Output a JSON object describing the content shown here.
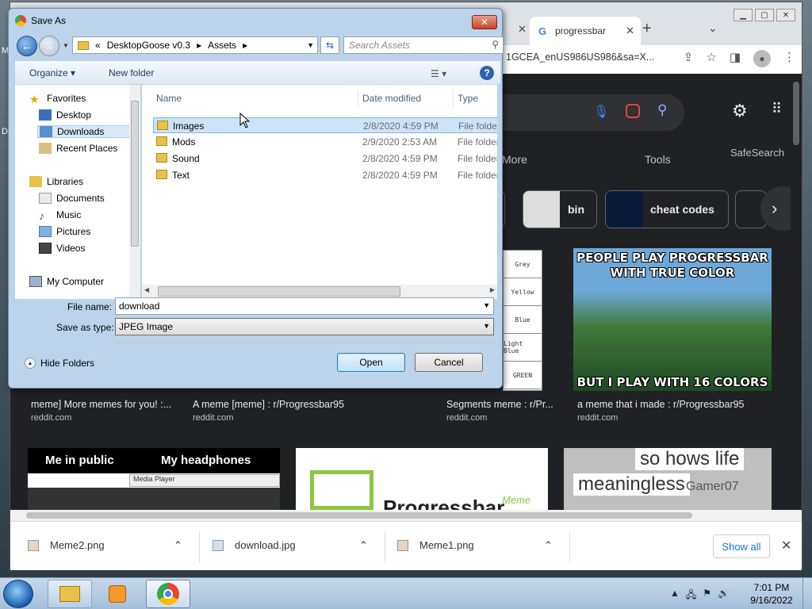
{
  "desktop": {
    "letters": [
      "M",
      "D"
    ]
  },
  "browser": {
    "tab_title": "progressbar",
    "url_fragment": "1GCEA_enUS986US986&sa=X...",
    "nav_more": "More",
    "nav_tools": "Tools",
    "nav_safesearch": "SafeSearch",
    "chips": [
      {
        "label": "bin"
      },
      {
        "label": "cheat codes"
      }
    ],
    "color_strip": [
      "Grey",
      "Yellow",
      "Blue",
      "Light Blue",
      "GREEN"
    ],
    "meme_top_text": "PEOPLE PLAY PROGRESSBAR WITH TRUE COLOR",
    "meme_bottom_text": "BUT I PLAY WITH 16 COLORS",
    "results": [
      {
        "title": "meme] More memes for you! :...",
        "source": "reddit.com"
      },
      {
        "title": "A meme [meme] : r/Progressbar95",
        "source": "reddit.com"
      },
      {
        "title": "Segments meme : r/Pr...",
        "source": "reddit.com"
      },
      {
        "title": "a meme that i made : r/Progressbar95",
        "source": "reddit.com"
      }
    ],
    "row2": {
      "public_text": "Me in public",
      "headphones_text": "My headphones",
      "media_player": "Media Player",
      "progressbar_text": "Progressbar",
      "meme_text": "Meme",
      "hows_life": "so hows life",
      "meaningless": "meaningless",
      "gamer": "Gamer07"
    },
    "downloads": [
      {
        "name": "Meme2.png"
      },
      {
        "name": "download.jpg"
      },
      {
        "name": "Meme1.png"
      }
    ],
    "show_all": "Show all"
  },
  "dialog": {
    "title": "Save As",
    "breadcrumb": [
      "«",
      "DesktopGoose v0.3",
      "▸",
      "Assets",
      "▸"
    ],
    "search_placeholder": "Search Assets",
    "organize": "Organize ▾",
    "new_folder": "New folder",
    "nav": [
      {
        "label": "Favorites",
        "icon": "star-icon"
      },
      {
        "label": "Desktop",
        "icon": "desktop-icon"
      },
      {
        "label": "Downloads",
        "icon": "downloads-icon",
        "selected": true
      },
      {
        "label": "Recent Places",
        "icon": "recent-places-icon"
      },
      {
        "label": "Libraries",
        "icon": "libraries-icon"
      },
      {
        "label": "Documents",
        "icon": "documents-icon"
      },
      {
        "label": "Music",
        "icon": "music-icon"
      },
      {
        "label": "Pictures",
        "icon": "pictures-icon"
      },
      {
        "label": "Videos",
        "icon": "videos-icon"
      },
      {
        "label": "My Computer",
        "icon": "computer-icon"
      }
    ],
    "columns": {
      "name": "Name",
      "date": "Date modified",
      "type": "Type"
    },
    "files": [
      {
        "name": "Images",
        "date": "2/8/2020 4:59 PM",
        "type": "File folder",
        "selected": true
      },
      {
        "name": "Mods",
        "date": "2/9/2020 2:53 AM",
        "type": "File folder"
      },
      {
        "name": "Sound",
        "date": "2/8/2020 4:59 PM",
        "type": "File folder"
      },
      {
        "name": "Text",
        "date": "2/8/2020 4:59 PM",
        "type": "File folder"
      }
    ],
    "file_name_label": "File name:",
    "file_name_value": "download",
    "save_type_label": "Save as type:",
    "save_type_value": "JPEG Image",
    "hide_folders": "Hide Folders",
    "open_button": "Open",
    "cancel_button": "Cancel"
  },
  "taskbar": {
    "time": "7:01 PM",
    "date": "9/16/2022"
  }
}
